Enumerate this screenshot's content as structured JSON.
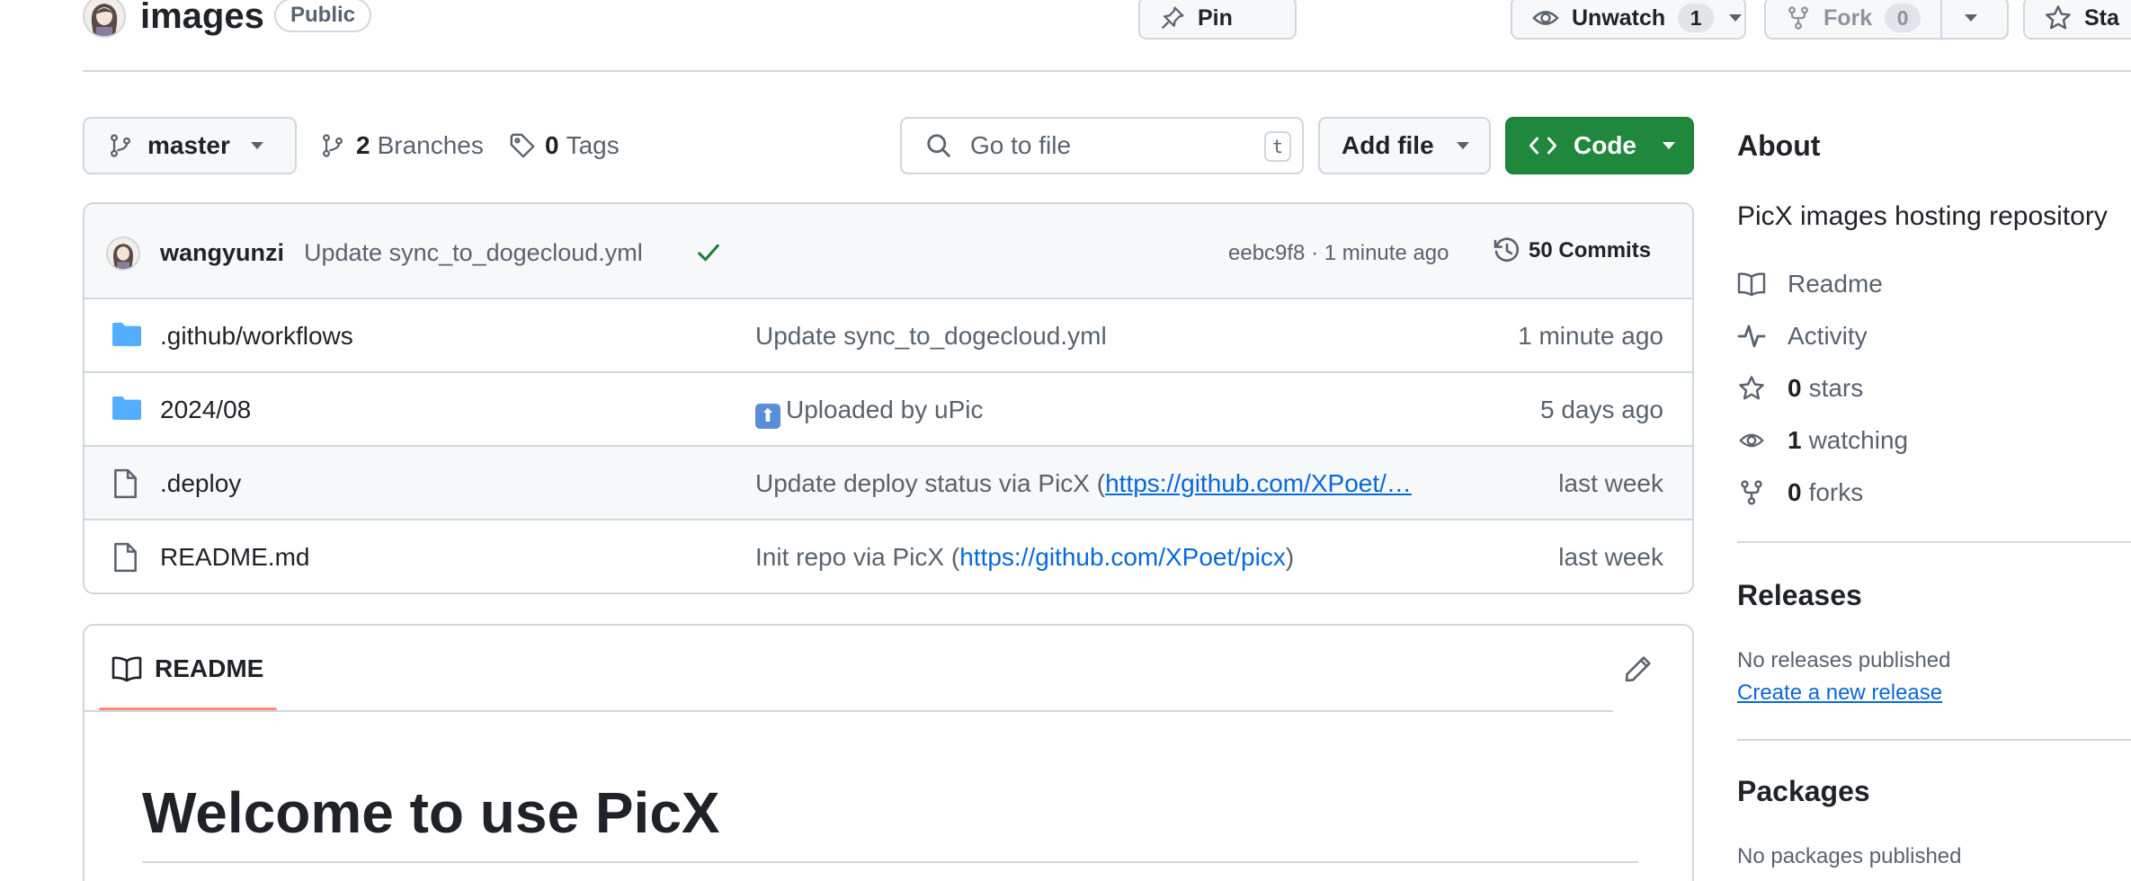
{
  "repo": {
    "name": "images",
    "visibility": "Public"
  },
  "header_actions": {
    "pin": "Pin",
    "unwatch": "Unwatch",
    "watch_count": "1",
    "fork": "Fork",
    "fork_count": "0",
    "star": "Sta"
  },
  "branch_bar": {
    "branch": "master",
    "branches_count": "2",
    "branches_label": "Branches",
    "tags_count": "0",
    "tags_label": "Tags",
    "search_placeholder": "Go to file",
    "search_shortcut": "t",
    "add_file": "Add file",
    "code": "Code"
  },
  "latest_commit": {
    "author": "wangyunzi",
    "message": "Update sync_to_dogecloud.yml",
    "hash_time": "eebc9f8 · 1 minute ago",
    "commits_label": "50 Commits"
  },
  "files": [
    {
      "type": "folder",
      "name": ".github/workflows",
      "message": "Update sync_to_dogecloud.yml",
      "time": "1 minute ago"
    },
    {
      "type": "folder",
      "name": "2024/08",
      "emoji": "⬆",
      "message": "Uploaded by uPic",
      "time": "5 days ago"
    },
    {
      "type": "file",
      "name": ".deploy",
      "message_prefix": "Update deploy status via PicX (",
      "message_link": "https://github.com/XPoet/…",
      "time": "last week"
    },
    {
      "type": "file",
      "name": "README.md",
      "message_prefix": "Init repo via PicX (",
      "message_link": "https://github.com/XPoet/picx",
      "message_suffix": ")",
      "time": "last week"
    }
  ],
  "readme": {
    "tab": "README",
    "heading": "Welcome to use PicX"
  },
  "sidebar": {
    "about_title": "About",
    "description": "PicX images hosting repository",
    "links": [
      {
        "label": "Readme"
      },
      {
        "label": "Activity"
      },
      {
        "count": "0",
        "label": "stars"
      },
      {
        "count": "1",
        "label": "watching"
      },
      {
        "count": "0",
        "label": "forks"
      }
    ],
    "releases_title": "Releases",
    "releases_text": "No releases published",
    "releases_link": "Create a new release",
    "packages_title": "Packages",
    "packages_text": "No packages published"
  },
  "colors": {
    "accent_green": "#1f883d",
    "link_blue": "#0969da",
    "folder_blue": "#54aeff",
    "tab_underline": "#fd8c73",
    "check_green": "#1a7f37"
  }
}
